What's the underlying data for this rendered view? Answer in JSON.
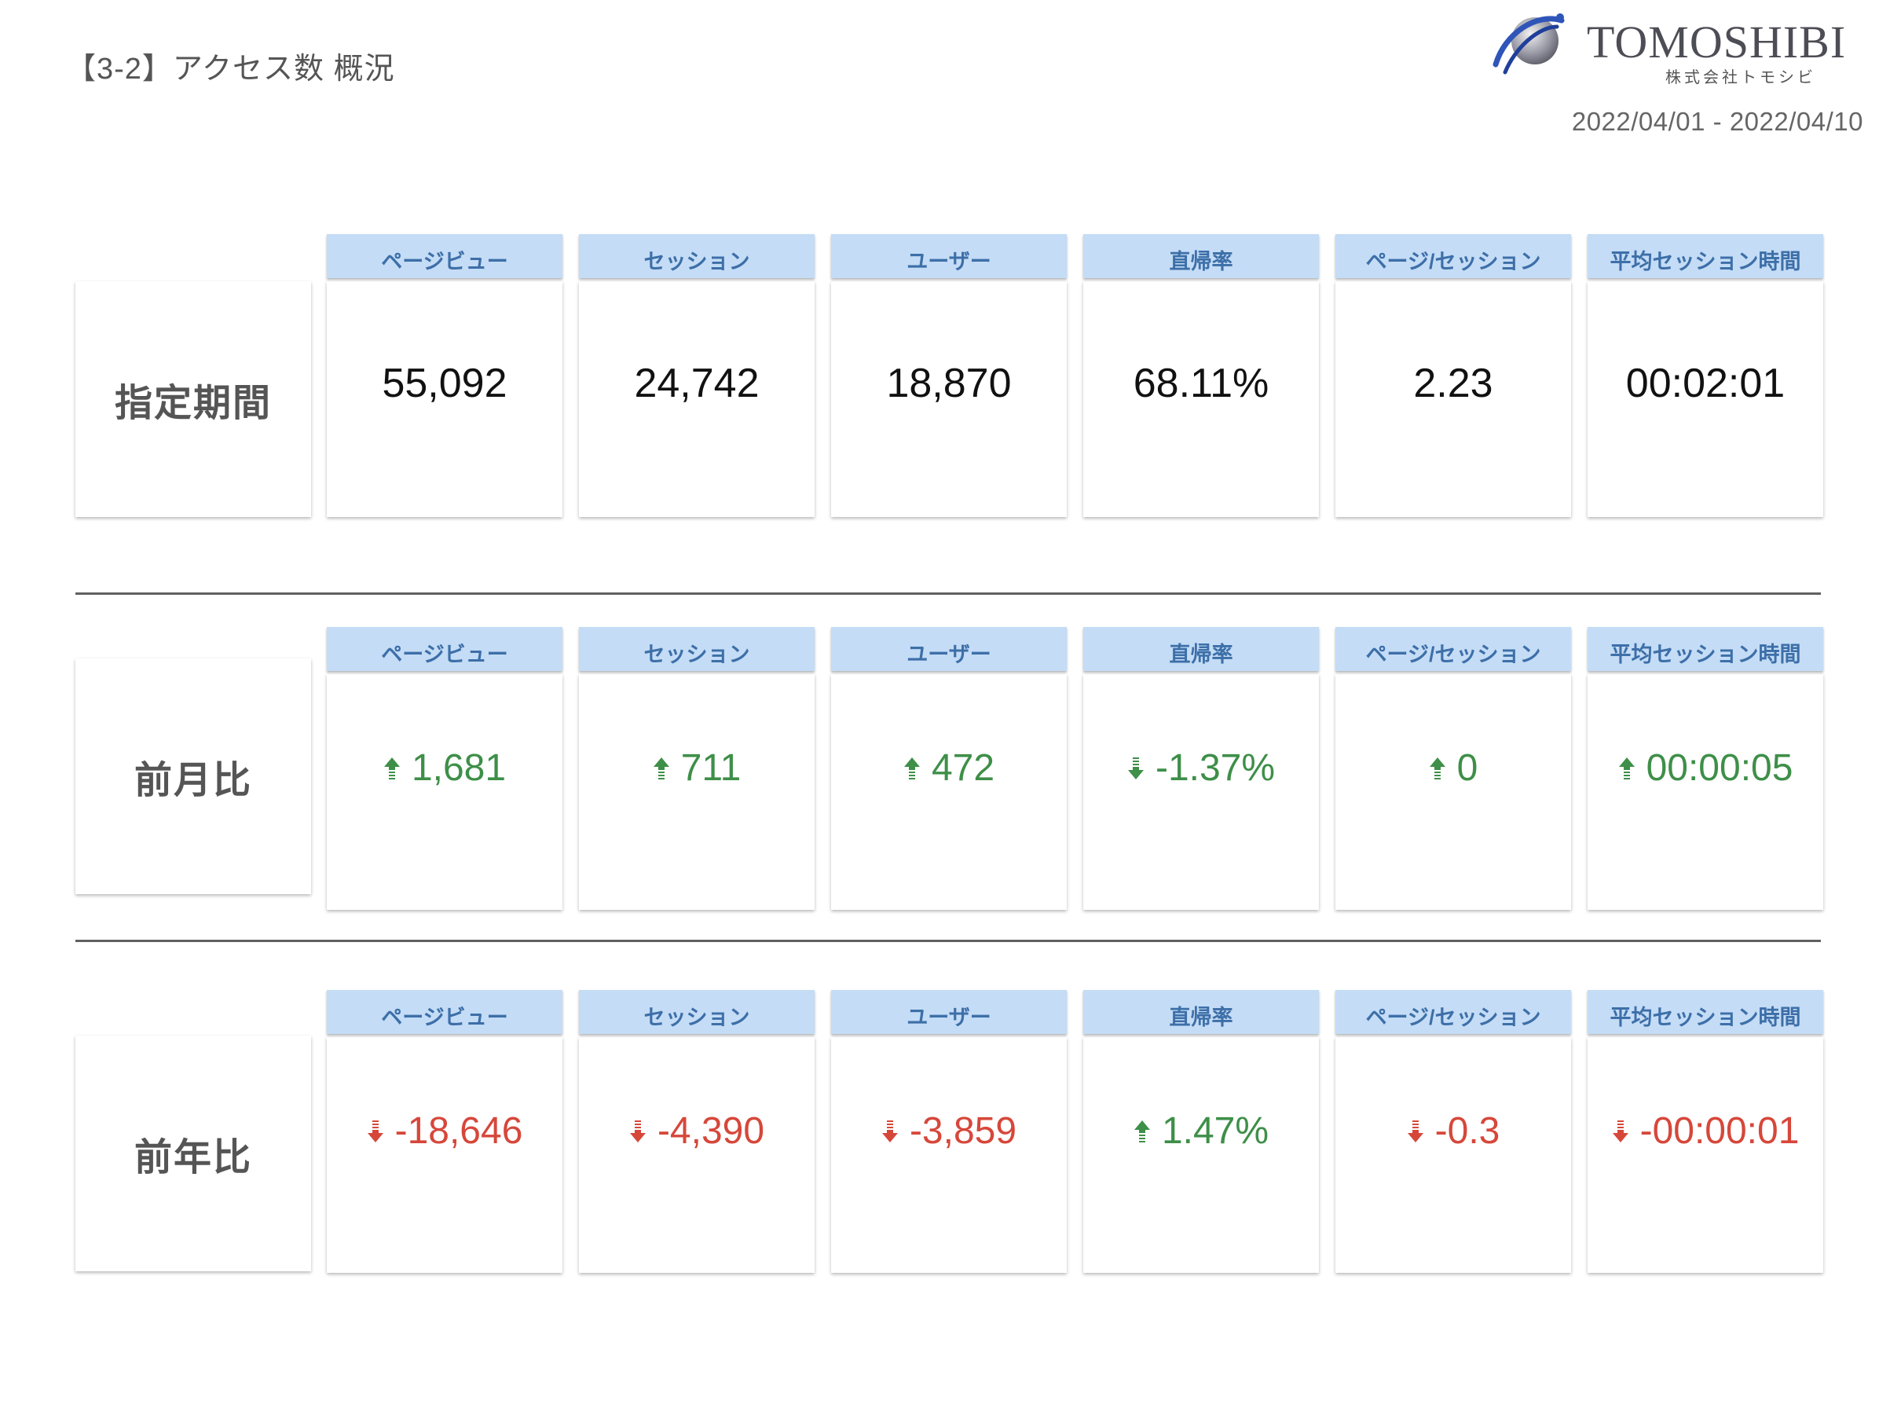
{
  "header": {
    "title": "【3-2】アクセス数 概況",
    "logo_name": "TOMOSHIBI",
    "logo_sub": "株式会社トモシビ",
    "date_range": "2022/04/01 - 2022/04/10"
  },
  "metric_labels": [
    "ページビュー",
    "セッション",
    "ユーザー",
    "直帰率",
    "ページ/セッション",
    "平均セッション時間"
  ],
  "rows": [
    {
      "label": "指定期間",
      "values": [
        "55,092",
        "24,742",
        "18,870",
        "68.11%",
        "2.23",
        "00:02:01"
      ]
    },
    {
      "label": "前月比",
      "deltas": [
        {
          "text": "1,681",
          "direction": "up",
          "color": "#3e8f48"
        },
        {
          "text": "711",
          "direction": "up",
          "color": "#3e8f48"
        },
        {
          "text": "472",
          "direction": "up",
          "color": "#3e8f48"
        },
        {
          "text": "-1.37%",
          "direction": "down",
          "color": "#3e8f48"
        },
        {
          "text": "0",
          "direction": "up",
          "color": "#3e8f48"
        },
        {
          "text": "00:00:05",
          "direction": "up",
          "color": "#3e8f48"
        }
      ]
    },
    {
      "label": "前年比",
      "deltas": [
        {
          "text": "-18,646",
          "direction": "down",
          "color": "#d6473a"
        },
        {
          "text": "-4,390",
          "direction": "down",
          "color": "#d6473a"
        },
        {
          "text": "-3,859",
          "direction": "down",
          "color": "#d6473a"
        },
        {
          "text": "1.47%",
          "direction": "up",
          "color": "#3e8f48"
        },
        {
          "text": "-0.3",
          "direction": "down",
          "color": "#d6473a"
        },
        {
          "text": "-00:00:01",
          "direction": "down",
          "color": "#d6473a"
        }
      ]
    }
  ],
  "colors": {
    "header_bg": "#c4dcf6",
    "header_text": "#3d6fa8",
    "positive": "#3e8f48",
    "negative": "#d6473a"
  }
}
